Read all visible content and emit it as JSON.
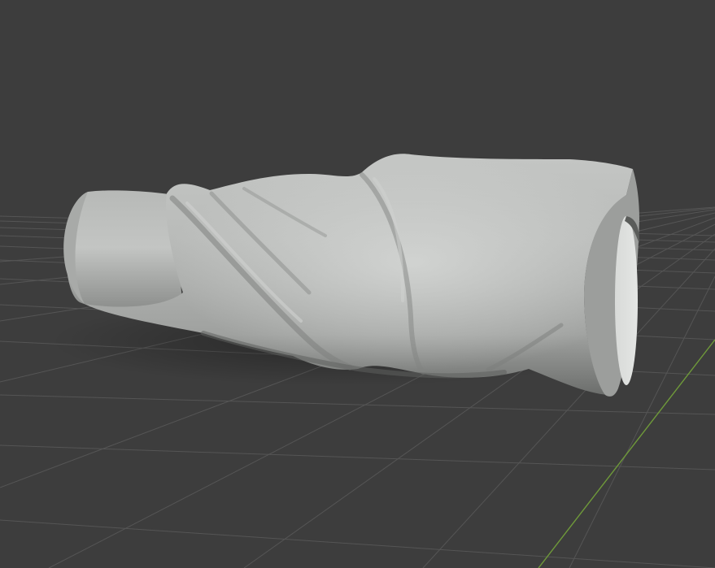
{
  "viewport": {
    "background_color": "#3d3d3d",
    "grid_line_color": "#555555",
    "x_axis_color": "#8b2c2c",
    "y_axis_color": "#6f9a3a",
    "mesh_base_color": "#a9aba9",
    "mesh_highlight_color": "#d6d8d6",
    "mesh_shadow_color": "#626462",
    "shading_mode": "solid"
  }
}
